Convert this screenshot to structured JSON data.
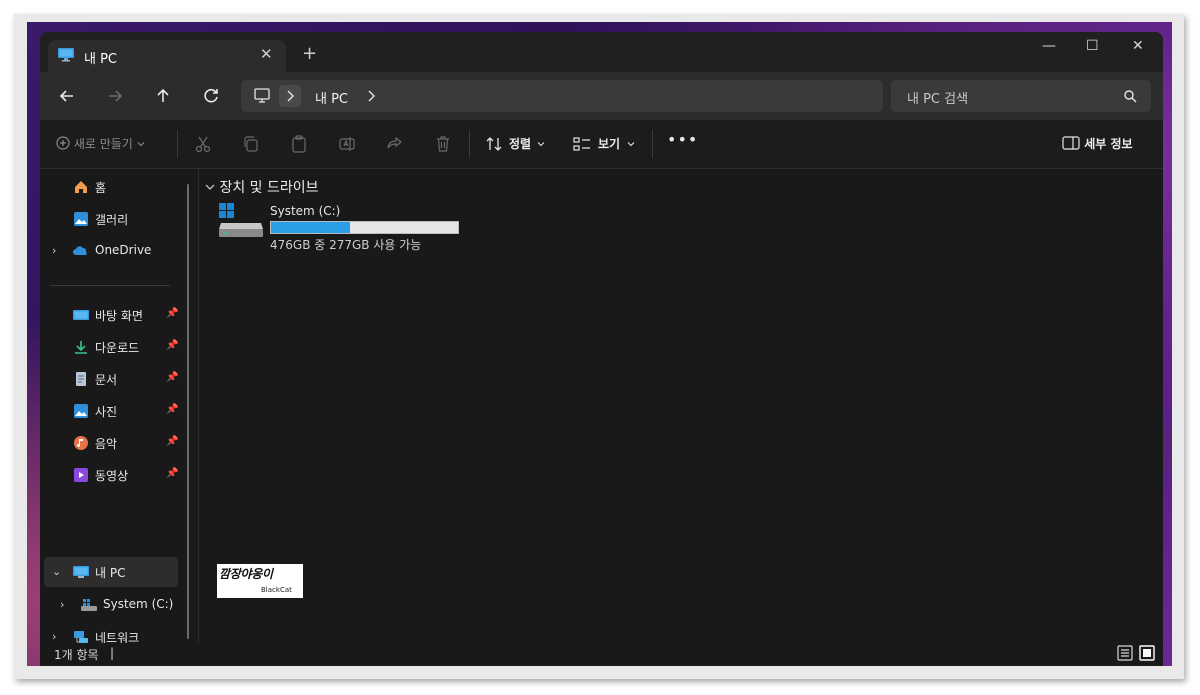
{
  "window": {
    "tab_title": "내 PC",
    "close_tab": "✕",
    "new_tab": "+",
    "minimize": "—",
    "maximize": "☐",
    "close": "✕"
  },
  "address": {
    "path_label": "내 PC",
    "search_placeholder": "내 PC 검색"
  },
  "toolbar": {
    "new_label": "새로 만들기",
    "sort_label": "정렬",
    "view_label": "보기",
    "more_label": "•••",
    "details_label": "세부 정보"
  },
  "sidebar": {
    "home": "홈",
    "gallery": "갤러리",
    "onedrive": "OneDrive",
    "desktop": "바탕 화면",
    "downloads": "다운로드",
    "documents": "문서",
    "pictures": "사진",
    "music": "음악",
    "videos": "동영상",
    "this_pc": "내 PC",
    "system_drive": "System (C:)",
    "network": "네트워크"
  },
  "content": {
    "group_title": "장치 및 드라이브",
    "drive_name": "System (C:)",
    "drive_used_fraction": 0.42,
    "drive_info": "476GB 중 277GB 사용 가능"
  },
  "watermark": {
    "main": "깜장야옹이",
    "sub": "BlackCat"
  },
  "status": {
    "item_count": "1개 항목"
  },
  "colors": {
    "accent": "#2a9ee6",
    "window_bg": "#191919",
    "titlebar_bg": "#202020",
    "navbar_bg": "#2c2c2c"
  }
}
